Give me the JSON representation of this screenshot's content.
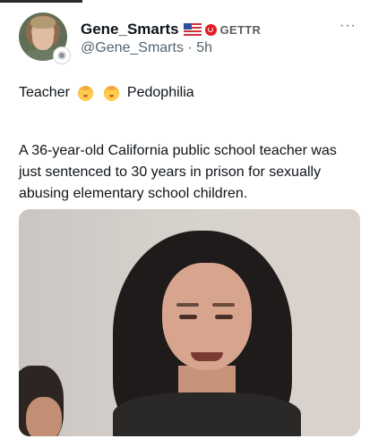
{
  "post": {
    "author_name": "Gene_Smarts",
    "platform_label": "GETTR",
    "handle": "@Gene_Smarts",
    "separator": "·",
    "time": "5h",
    "more_menu": "···",
    "line1_part1": "Teacher",
    "line1_part2": "Pedophilia",
    "body": "A 36-year-old California public school teacher was just sentenced to 30 years in prison for sexually abusing elementary school children."
  },
  "icons": {
    "flag": "us-flag-icon",
    "platform": "gettr-logo-icon",
    "emoji": "baby-emoji-icon",
    "verified": "badge-icon"
  },
  "colors": {
    "text_primary": "#0f1419",
    "text_secondary": "#536471",
    "gettr_red": "#e21c23"
  }
}
